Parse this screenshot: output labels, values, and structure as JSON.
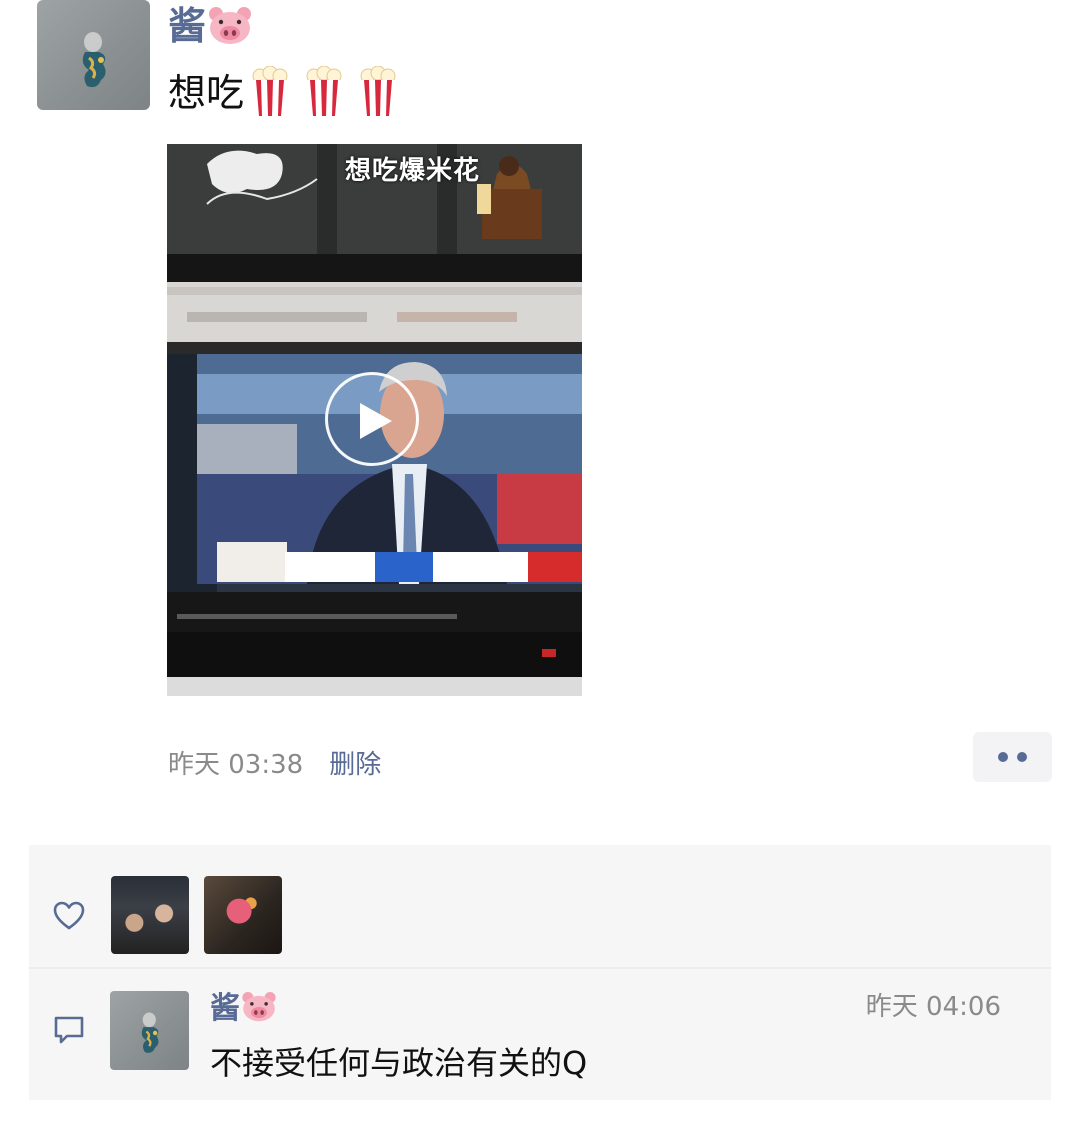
{
  "post": {
    "author": "酱",
    "author_emoji": "pig-face-icon",
    "text": "想吃",
    "text_emojis": [
      "popcorn-icon",
      "popcorn-icon",
      "popcorn-icon"
    ],
    "video": {
      "caption": "想吃爆米花",
      "play_icon": "play-icon"
    },
    "time": "昨天 03:38",
    "delete_label": "删除",
    "more_icon": "more-dots-icon"
  },
  "likes": {
    "icon": "heart-icon",
    "users": [
      "like-user-1",
      "like-user-2"
    ]
  },
  "comments": [
    {
      "author": "酱",
      "author_emoji": "pig-face-icon",
      "time": "昨天 04:06",
      "text": "不接受任何与政治有关的Q"
    }
  ],
  "colors": {
    "link": "#576b95",
    "muted": "#8a8a8a",
    "panel_bg": "#f6f6f6"
  }
}
